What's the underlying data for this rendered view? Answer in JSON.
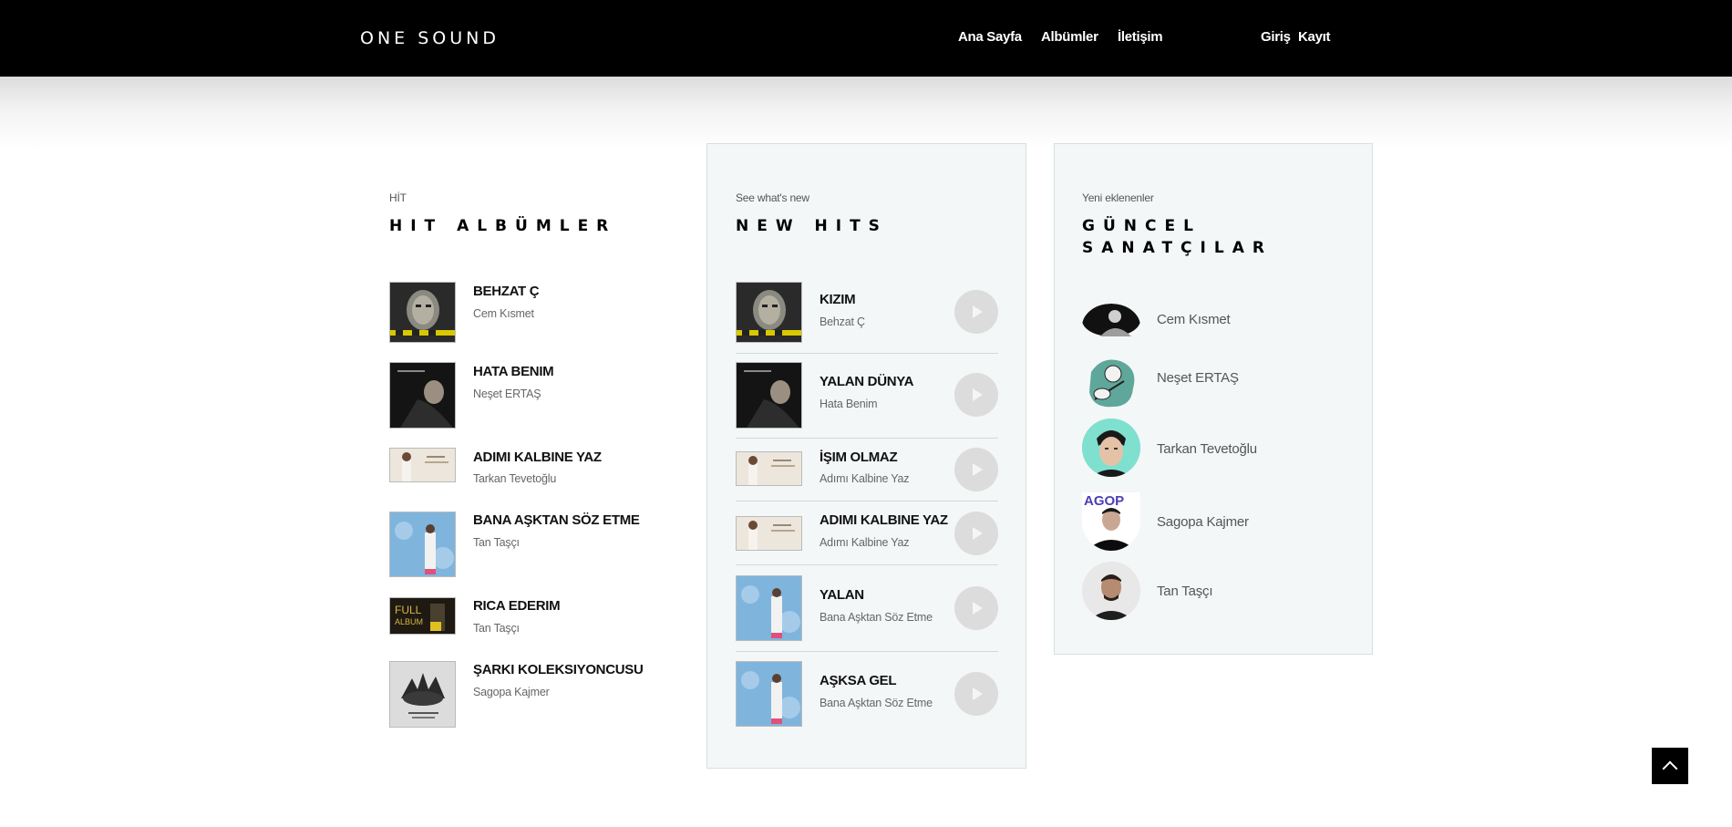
{
  "header": {
    "brand": "ONE SOUND",
    "nav": [
      "Ana Sayfa",
      "Albümler",
      "İletişim"
    ],
    "auth": [
      "Giriş",
      "Kayıt"
    ]
  },
  "hit_albums": {
    "kicker": "HİT",
    "title": "HIT ALBÜMLER",
    "items": [
      {
        "title": "BEHZAT Ç",
        "artist": "Cem Kısmet"
      },
      {
        "title": "HATA BENIM",
        "artist": "Neşet ERTAŞ"
      },
      {
        "title": "ADIMI KALBINE YAZ",
        "artist": "Tarkan Tevetoğlu"
      },
      {
        "title": "BANA AŞKTAN SÖZ ETME",
        "artist": "Tan Taşçı"
      },
      {
        "title": "RICA EDERIM",
        "artist": "Tan Taşçı"
      },
      {
        "title": "ŞARKI KOLEKSIYONCUSU",
        "artist": "Sagopa Kajmer"
      }
    ]
  },
  "new_hits": {
    "kicker": "See what's new",
    "title": "NEW HITS",
    "items": [
      {
        "title": "KIZIM",
        "album": "Behzat Ç"
      },
      {
        "title": "YALAN DÜNYA",
        "album": "Hata Benim"
      },
      {
        "title": "İŞIM OLMAZ",
        "album": "Adımı Kalbine Yaz"
      },
      {
        "title": "ADIMI KALBINE YAZ",
        "album": "Adımı Kalbine Yaz"
      },
      {
        "title": "YALAN",
        "album": "Bana Aşktan Söz Etme"
      },
      {
        "title": "AŞKSA GEL",
        "album": "Bana Aşktan Söz Etme"
      }
    ]
  },
  "artists": {
    "kicker": "Yeni eklenenler",
    "title_line1": "GÜNCEL",
    "title_line2": "SANATÇILAR",
    "items": [
      {
        "name": "Cem Kısmet"
      },
      {
        "name": "Neşet ERTAŞ"
      },
      {
        "name": "Tarkan Tevetoğlu"
      },
      {
        "name": "Sagopa Kajmer"
      },
      {
        "name": "Tan Taşçı"
      }
    ]
  },
  "cover_art": {
    "full_album_text_1": "FULL",
    "full_album_text_2": "ALBUM",
    "sagopa_logo_text": "AGOP"
  },
  "colors": {
    "header_bg": "#000000",
    "panel_bg": "#f4f7f7",
    "play_button": "#dcdcdc"
  }
}
